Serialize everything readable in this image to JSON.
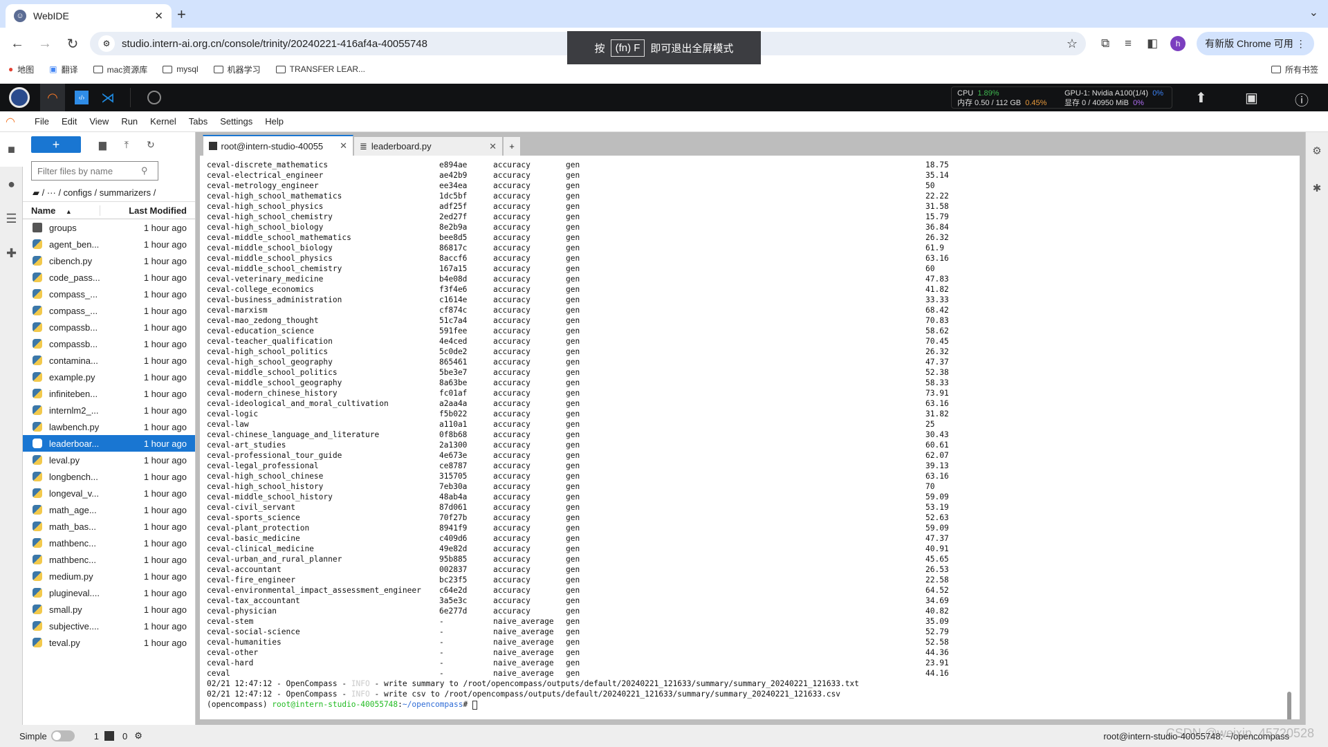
{
  "browser": {
    "tab_title": "WebIDE",
    "url": "studio.intern-ai.org.cn/console/trinity/20240221-416af4a-40055748",
    "avatar_letter": "h",
    "update_label": "有新版 Chrome 可用",
    "bookmarks": [
      "地图",
      "翻译",
      "mac资源库",
      "mysql",
      "机器学习",
      "TRANSFER LEAR..."
    ],
    "all_bookmarks": "所有书签",
    "fullscreen_toast": {
      "prefix": "按",
      "key": "(fn) F",
      "suffix": "即可退出全屏模式"
    }
  },
  "resources": {
    "cpu_label": "CPU",
    "cpu_value": "1.89%",
    "mem_label": "内存 0.50 / 112 GB",
    "mem_value": "0.45%",
    "gpu_label": "GPU-1: Nvidia A100(1/4)",
    "gpu_value": "0%",
    "vram_label": "显存 0 / 40950 MiB",
    "vram_value": "0%"
  },
  "menu": [
    "File",
    "Edit",
    "View",
    "Run",
    "Kernel",
    "Tabs",
    "Settings",
    "Help"
  ],
  "file_browser": {
    "filter_placeholder": "Filter files by name",
    "breadcrumb": "/  ···  / configs / summarizers /",
    "col_name": "Name",
    "col_modified": "Last Modified",
    "files": [
      {
        "name": "groups",
        "type": "folder",
        "modified": "1 hour ago"
      },
      {
        "name": "agent_ben...",
        "type": "py",
        "modified": "1 hour ago"
      },
      {
        "name": "cibench.py",
        "type": "py",
        "modified": "1 hour ago"
      },
      {
        "name": "code_pass...",
        "type": "py",
        "modified": "1 hour ago"
      },
      {
        "name": "compass_...",
        "type": "py",
        "modified": "1 hour ago"
      },
      {
        "name": "compass_...",
        "type": "py",
        "modified": "1 hour ago"
      },
      {
        "name": "compassb...",
        "type": "py",
        "modified": "1 hour ago"
      },
      {
        "name": "compassb...",
        "type": "py",
        "modified": "1 hour ago"
      },
      {
        "name": "contamina...",
        "type": "py",
        "modified": "1 hour ago"
      },
      {
        "name": "example.py",
        "type": "py",
        "modified": "1 hour ago"
      },
      {
        "name": "infiniteben...",
        "type": "py",
        "modified": "1 hour ago"
      },
      {
        "name": "internlm2_...",
        "type": "py",
        "modified": "1 hour ago"
      },
      {
        "name": "lawbench.py",
        "type": "py",
        "modified": "1 hour ago"
      },
      {
        "name": "leaderboar...",
        "type": "py",
        "modified": "1 hour ago",
        "selected": true
      },
      {
        "name": "leval.py",
        "type": "py",
        "modified": "1 hour ago"
      },
      {
        "name": "longbench...",
        "type": "py",
        "modified": "1 hour ago"
      },
      {
        "name": "longeval_v...",
        "type": "py",
        "modified": "1 hour ago"
      },
      {
        "name": "math_age...",
        "type": "py",
        "modified": "1 hour ago"
      },
      {
        "name": "math_bas...",
        "type": "py",
        "modified": "1 hour ago"
      },
      {
        "name": "mathbenc...",
        "type": "py",
        "modified": "1 hour ago"
      },
      {
        "name": "mathbenc...",
        "type": "py",
        "modified": "1 hour ago"
      },
      {
        "name": "medium.py",
        "type": "py",
        "modified": "1 hour ago"
      },
      {
        "name": "plugineval....",
        "type": "py",
        "modified": "1 hour ago"
      },
      {
        "name": "small.py",
        "type": "py",
        "modified": "1 hour ago"
      },
      {
        "name": "subjective....",
        "type": "py",
        "modified": "1 hour ago"
      },
      {
        "name": "teval.py",
        "type": "py",
        "modified": "1 hour ago"
      }
    ]
  },
  "doc_tabs": [
    {
      "label": "root@intern-studio-40055",
      "type": "terminal",
      "active": true
    },
    {
      "label": "leaderboard.py",
      "type": "file",
      "active": false
    }
  ],
  "terminal": {
    "rows": [
      [
        "ceval-discrete_mathematics",
        "e894ae",
        "accuracy",
        "gen",
        "18.75"
      ],
      [
        "ceval-electrical_engineer",
        "ae42b9",
        "accuracy",
        "gen",
        "35.14"
      ],
      [
        "ceval-metrology_engineer",
        "ee34ea",
        "accuracy",
        "gen",
        "50"
      ],
      [
        "ceval-high_school_mathematics",
        "1dc5bf",
        "accuracy",
        "gen",
        "22.22"
      ],
      [
        "ceval-high_school_physics",
        "adf25f",
        "accuracy",
        "gen",
        "31.58"
      ],
      [
        "ceval-high_school_chemistry",
        "2ed27f",
        "accuracy",
        "gen",
        "15.79"
      ],
      [
        "ceval-high_school_biology",
        "8e2b9a",
        "accuracy",
        "gen",
        "36.84"
      ],
      [
        "ceval-middle_school_mathematics",
        "bee8d5",
        "accuracy",
        "gen",
        "26.32"
      ],
      [
        "ceval-middle_school_biology",
        "86817c",
        "accuracy",
        "gen",
        "61.9"
      ],
      [
        "ceval-middle_school_physics",
        "8accf6",
        "accuracy",
        "gen",
        "63.16"
      ],
      [
        "ceval-middle_school_chemistry",
        "167a15",
        "accuracy",
        "gen",
        "60"
      ],
      [
        "ceval-veterinary_medicine",
        "b4e08d",
        "accuracy",
        "gen",
        "47.83"
      ],
      [
        "ceval-college_economics",
        "f3f4e6",
        "accuracy",
        "gen",
        "41.82"
      ],
      [
        "ceval-business_administration",
        "c1614e",
        "accuracy",
        "gen",
        "33.33"
      ],
      [
        "ceval-marxism",
        "cf874c",
        "accuracy",
        "gen",
        "68.42"
      ],
      [
        "ceval-mao_zedong_thought",
        "51c7a4",
        "accuracy",
        "gen",
        "70.83"
      ],
      [
        "ceval-education_science",
        "591fee",
        "accuracy",
        "gen",
        "58.62"
      ],
      [
        "ceval-teacher_qualification",
        "4e4ced",
        "accuracy",
        "gen",
        "70.45"
      ],
      [
        "ceval-high_school_politics",
        "5c0de2",
        "accuracy",
        "gen",
        "26.32"
      ],
      [
        "ceval-high_school_geography",
        "865461",
        "accuracy",
        "gen",
        "47.37"
      ],
      [
        "ceval-middle_school_politics",
        "5be3e7",
        "accuracy",
        "gen",
        "52.38"
      ],
      [
        "ceval-middle_school_geography",
        "8a63be",
        "accuracy",
        "gen",
        "58.33"
      ],
      [
        "ceval-modern_chinese_history",
        "fc01af",
        "accuracy",
        "gen",
        "73.91"
      ],
      [
        "ceval-ideological_and_moral_cultivation",
        "a2aa4a",
        "accuracy",
        "gen",
        "63.16"
      ],
      [
        "ceval-logic",
        "f5b022",
        "accuracy",
        "gen",
        "31.82"
      ],
      [
        "ceval-law",
        "a110a1",
        "accuracy",
        "gen",
        "25"
      ],
      [
        "ceval-chinese_language_and_literature",
        "0f8b68",
        "accuracy",
        "gen",
        "30.43"
      ],
      [
        "ceval-art_studies",
        "2a1300",
        "accuracy",
        "gen",
        "60.61"
      ],
      [
        "ceval-professional_tour_guide",
        "4e673e",
        "accuracy",
        "gen",
        "62.07"
      ],
      [
        "ceval-legal_professional",
        "ce8787",
        "accuracy",
        "gen",
        "39.13"
      ],
      [
        "ceval-high_school_chinese",
        "315705",
        "accuracy",
        "gen",
        "63.16"
      ],
      [
        "ceval-high_school_history",
        "7eb30a",
        "accuracy",
        "gen",
        "70"
      ],
      [
        "ceval-middle_school_history",
        "48ab4a",
        "accuracy",
        "gen",
        "59.09"
      ],
      [
        "ceval-civil_servant",
        "87d061",
        "accuracy",
        "gen",
        "53.19"
      ],
      [
        "ceval-sports_science",
        "70f27b",
        "accuracy",
        "gen",
        "52.63"
      ],
      [
        "ceval-plant_protection",
        "8941f9",
        "accuracy",
        "gen",
        "59.09"
      ],
      [
        "ceval-basic_medicine",
        "c409d6",
        "accuracy",
        "gen",
        "47.37"
      ],
      [
        "ceval-clinical_medicine",
        "49e82d",
        "accuracy",
        "gen",
        "40.91"
      ],
      [
        "ceval-urban_and_rural_planner",
        "95b885",
        "accuracy",
        "gen",
        "45.65"
      ],
      [
        "ceval-accountant",
        "002837",
        "accuracy",
        "gen",
        "26.53"
      ],
      [
        "ceval-fire_engineer",
        "bc23f5",
        "accuracy",
        "gen",
        "22.58"
      ],
      [
        "ceval-environmental_impact_assessment_engineer",
        "c64e2d",
        "accuracy",
        "gen",
        "64.52"
      ],
      [
        "ceval-tax_accountant",
        "3a5e3c",
        "accuracy",
        "gen",
        "34.69"
      ],
      [
        "ceval-physician",
        "6e277d",
        "accuracy",
        "gen",
        "40.82"
      ],
      [
        "ceval-stem",
        "-",
        "naive_average",
        "gen",
        "35.09"
      ],
      [
        "ceval-social-science",
        "-",
        "naive_average",
        "gen",
        "52.79"
      ],
      [
        "ceval-humanities",
        "-",
        "naive_average",
        "gen",
        "52.58"
      ],
      [
        "ceval-other",
        "-",
        "naive_average",
        "gen",
        "44.36"
      ],
      [
        "ceval-hard",
        "-",
        "naive_average",
        "gen",
        "23.91"
      ],
      [
        "ceval",
        "-",
        "naive_average",
        "gen",
        "44.16"
      ]
    ],
    "logs": [
      {
        "prefix": "02/21 12:47:12 - OpenCompass - ",
        "level": "INFO",
        "msg": " - write summary to /root/opencompass/outputs/default/20240221_121633/summary/summary_20240221_121633.txt"
      },
      {
        "prefix": "02/21 12:47:12 - OpenCompass - ",
        "level": "INFO",
        "msg": " - write csv to /root/opencompass/outputs/default/20240221_121633/summary/summary_20240221_121633.csv"
      }
    ],
    "prompt_env": "(opencompass) ",
    "prompt_user": "root@intern-studio-40055748",
    "prompt_path": "~/opencompass",
    "prompt_end": "# "
  },
  "status_bar": {
    "mode_label": "Simple",
    "terminals_count": "1",
    "kernels_count": "0",
    "right_text": "root@intern-studio-40055748: ~/opencompass"
  },
  "watermark": "CSDN @weixin_45720528"
}
